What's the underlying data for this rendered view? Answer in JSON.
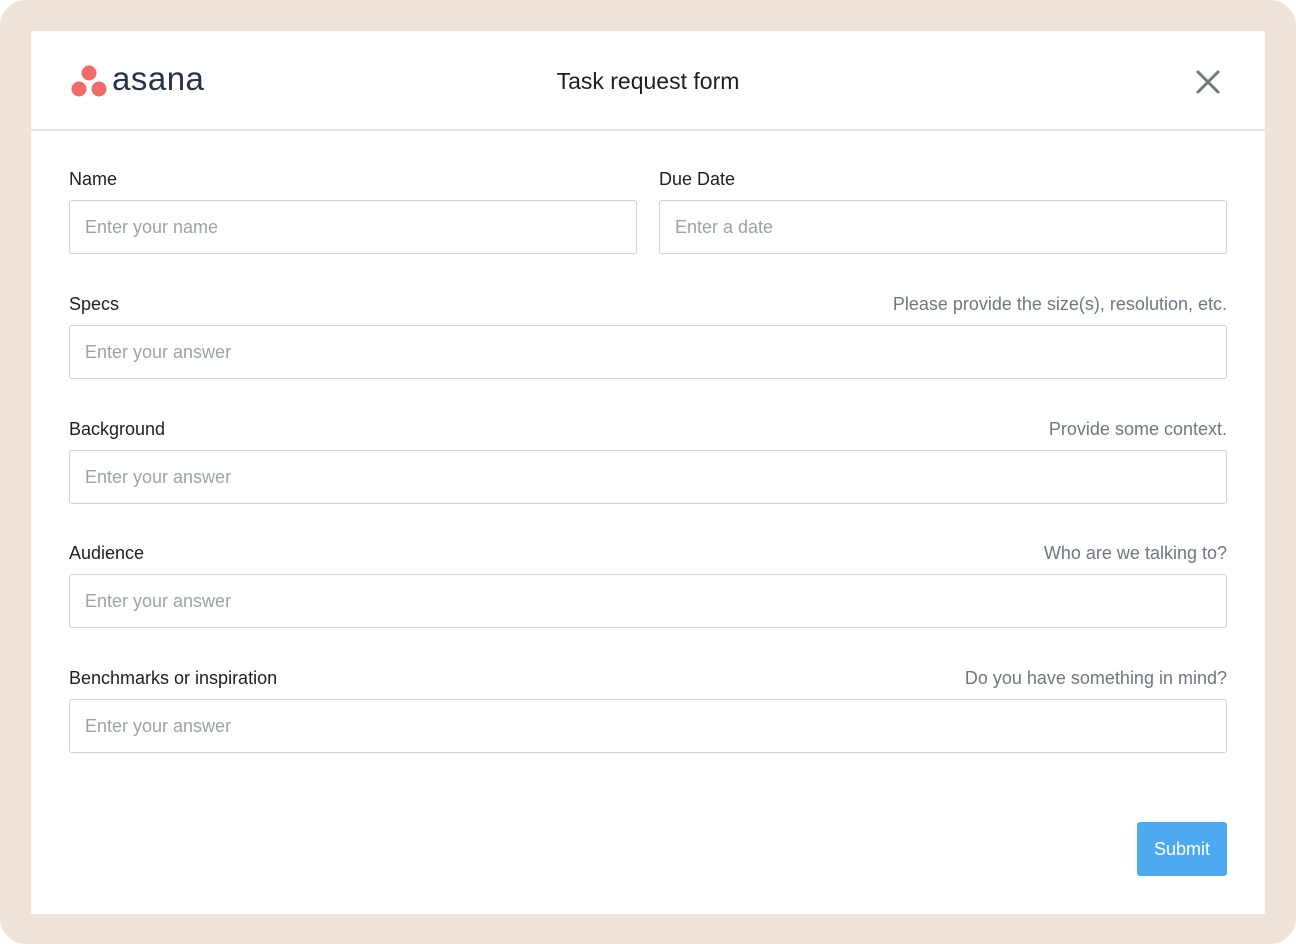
{
  "brand": {
    "name": "asana",
    "dot_color": "#f06a6a",
    "text_color": "#273347"
  },
  "header": {
    "title": "Task request form",
    "close_icon": "close-icon"
  },
  "fields": {
    "name": {
      "label": "Name",
      "placeholder": "Enter your name"
    },
    "due_date": {
      "label": "Due Date",
      "placeholder": "Enter a date"
    },
    "specs": {
      "label": "Specs",
      "hint": "Please provide the size(s), resolution, etc.",
      "placeholder": "Enter your answer"
    },
    "background": {
      "label": "Background",
      "hint": "Provide some context.",
      "placeholder": "Enter your answer"
    },
    "audience": {
      "label": "Audience",
      "hint": "Who are we talking to?",
      "placeholder": "Enter your answer"
    },
    "benchmarks": {
      "label": "Benchmarks or inspiration",
      "hint": "Do you have something in mind?",
      "placeholder": "Enter your answer"
    }
  },
  "actions": {
    "submit_label": "Submit",
    "submit_color": "#4eaaf0"
  },
  "colors": {
    "frame": "#efe4d9",
    "card": "#ffffff",
    "hint_text": "#6f7782",
    "placeholder_text": "#9ca3ab"
  }
}
